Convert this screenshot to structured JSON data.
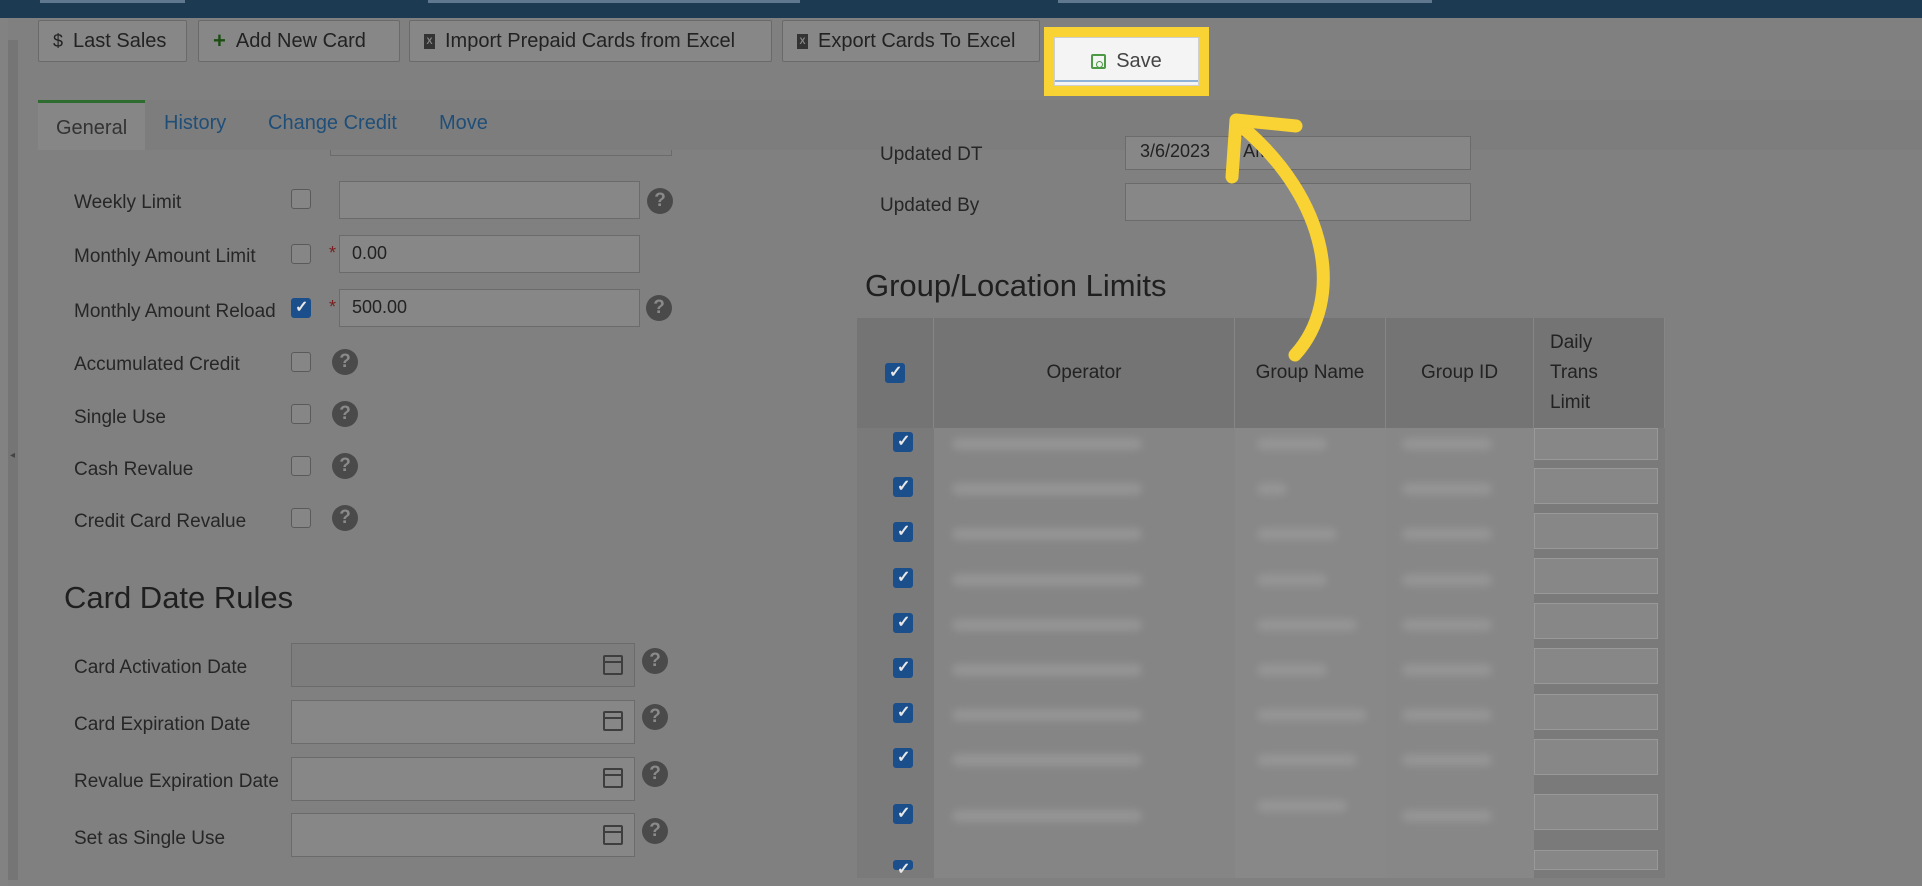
{
  "toolbar": {
    "last_sales": "Last Sales",
    "add_new_card": "Add New Card",
    "import_prepaid": "Import Prepaid Cards from Excel",
    "export_cards": "Export Cards To Excel",
    "save": "Save"
  },
  "tabs": [
    "General",
    "History",
    "Change Credit",
    "Move"
  ],
  "left": {
    "weekly_limit": "Weekly Limit",
    "monthly_amount_limit": "Monthly Amount Limit",
    "monthly_amount_limit_value": "0.00",
    "monthly_amount_reload": "Monthly Amount Reload",
    "monthly_amount_reload_value": "500.00",
    "accumulated_credit": "Accumulated Credit",
    "single_use": "Single Use",
    "cash_revalue": "Cash Revalue",
    "credit_card_revalue": "Credit Card Revalue",
    "required_mark": "*",
    "help_glyph": "?"
  },
  "card_date_rules": {
    "title": "Card Date Rules",
    "activation": "Card Activation Date",
    "expiration": "Card Expiration Date",
    "revalue_expiration": "Revalue Expiration Date",
    "single_use": "Set as Single Use"
  },
  "right": {
    "updated_dt_label": "Updated DT",
    "updated_dt_value": "3/6/2023",
    "updated_dt_suffix": "AM",
    "updated_by_label": "Updated By",
    "group_title": "Group/Location Limits",
    "columns": {
      "operator": "Operator",
      "group_name": "Group Name",
      "group_id": "Group ID",
      "daily_trans_limit_1": "Daily",
      "daily_trans_limit_2": "Trans",
      "daily_trans_limit_3": "Limit"
    }
  },
  "icons": {
    "dollar": "$",
    "plus": "+",
    "excel": "X"
  },
  "colors": {
    "highlight": "#f9d233",
    "save_icon": "#4c9a43",
    "checkbox_on": "#1a4f8c"
  }
}
